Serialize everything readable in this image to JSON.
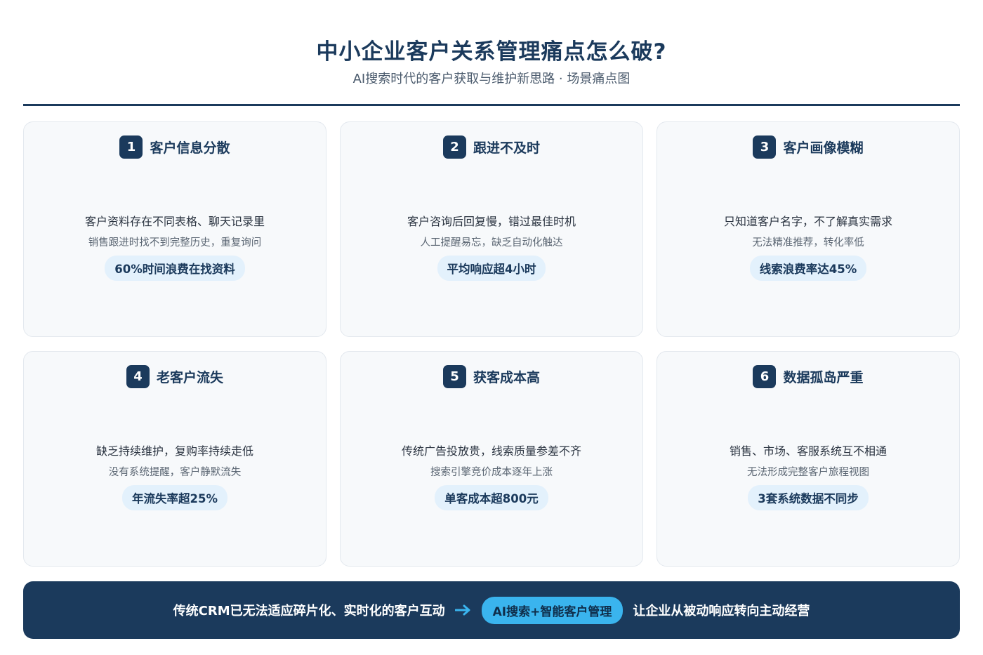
{
  "header": {
    "title": "中小企业客户关系管理痛点怎么破?",
    "subtitle": "AI搜索时代的客户获取与维护新思路 · 场景痛点图"
  },
  "cards": [
    {
      "num": "1",
      "title": "客户信息分散",
      "desc1": "客户资料存在不同表格、聊天记录里",
      "desc2": "销售跟进时找不到完整历史，重复询问",
      "stat": "60%时间浪费在找资料"
    },
    {
      "num": "2",
      "title": "跟进不及时",
      "desc1": "客户咨询后回复慢，错过最佳时机",
      "desc2": "人工提醒易忘，缺乏自动化触达",
      "stat": "平均响应超4小时"
    },
    {
      "num": "3",
      "title": "客户画像模糊",
      "desc1": "只知道客户名字，不了解真实需求",
      "desc2": "无法精准推荐，转化率低",
      "stat": "线索浪费率达45%"
    },
    {
      "num": "4",
      "title": "老客户流失",
      "desc1": "缺乏持续维护，复购率持续走低",
      "desc2": "没有系统提醒，客户静默流失",
      "stat": "年流失率超25%"
    },
    {
      "num": "5",
      "title": "获客成本高",
      "desc1": "传统广告投放贵，线索质量参差不齐",
      "desc2": "搜索引擎竞价成本逐年上涨",
      "stat": "单客成本超800元"
    },
    {
      "num": "6",
      "title": "数据孤岛严重",
      "desc1": "销售、市场、客服系统互不相通",
      "desc2": "无法形成完整客户旅程视图",
      "stat": "3套系统数据不同步"
    }
  ],
  "footer": {
    "left_text": "传统CRM已无法适应碎片化、实时化的客户互动",
    "arrow_icon": "arrow-right-icon",
    "highlight": "AI搜索+智能客户管理",
    "right_text": "让企业从被动响应转向主动经营"
  },
  "colors": {
    "primary": "#1b3a5c",
    "accent": "#3ab4ee",
    "pill_bg": "#e3f1fc",
    "card_bg": "#f7f9fb"
  }
}
